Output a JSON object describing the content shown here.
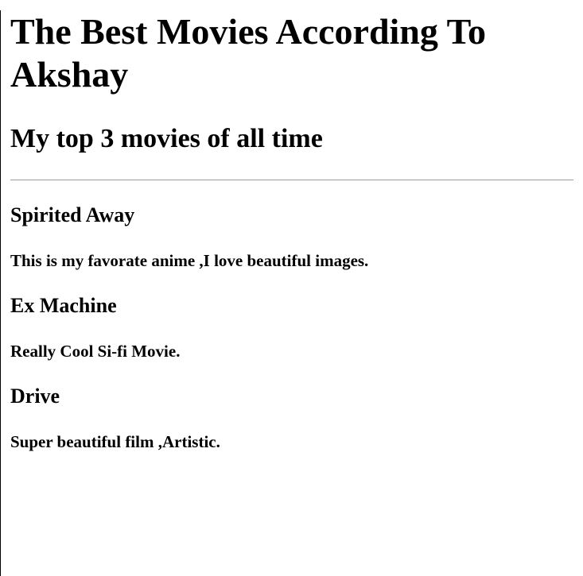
{
  "page": {
    "title": "The Best Movies According To Akshay",
    "subtitle": "My top 3 movies of all time"
  },
  "movies": [
    {
      "title": "Spirited Away",
      "description": "This is my favorate anime ,I love beautiful images."
    },
    {
      "title": "Ex Machine",
      "description": "Really Cool Si-fi Movie."
    },
    {
      "title": "Drive",
      "description": "Super beautiful film ,Artistic."
    }
  ]
}
